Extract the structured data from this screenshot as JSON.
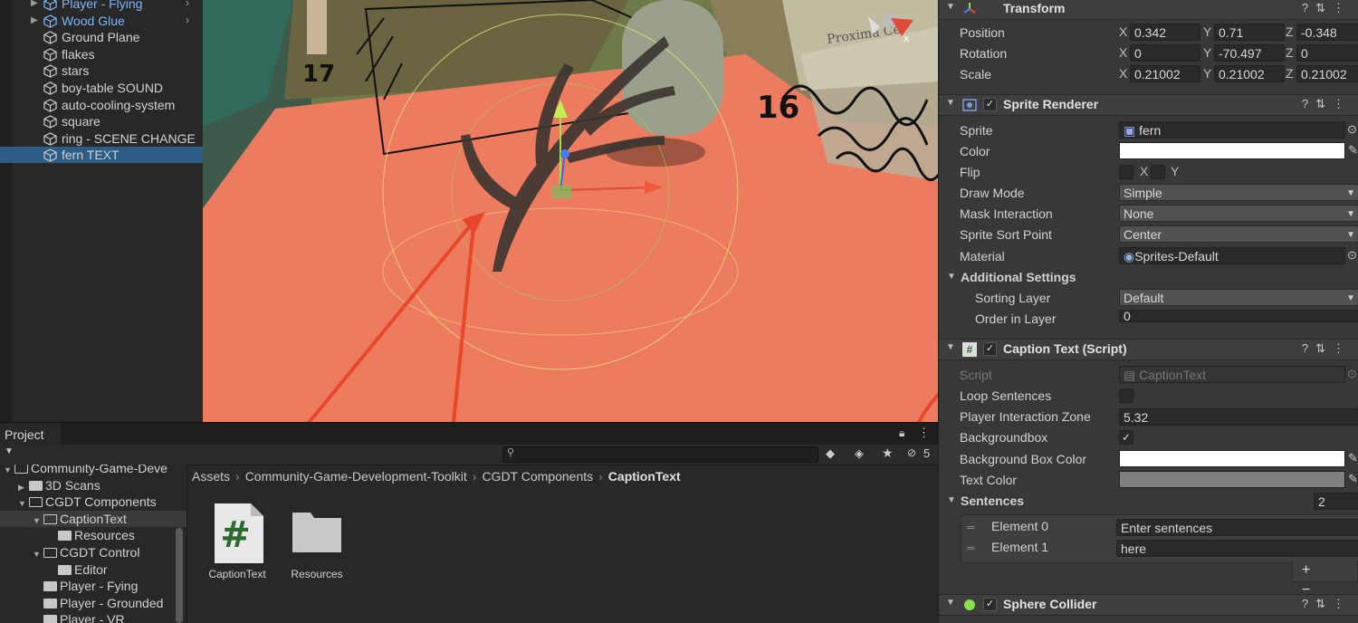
{
  "hierarchy": {
    "items": [
      {
        "label": "Player - Flying",
        "prefab": true
      },
      {
        "label": "Wood Glue",
        "prefab": true
      },
      {
        "label": "Ground Plane",
        "prefab": false
      },
      {
        "label": "flakes",
        "prefab": false
      },
      {
        "label": "stars",
        "prefab": false
      },
      {
        "label": "boy-table SOUND",
        "prefab": false
      },
      {
        "label": "auto-cooling-system",
        "prefab": false
      },
      {
        "label": "square",
        "prefab": false
      },
      {
        "label": "ring - SCENE CHANGE",
        "prefab": false
      },
      {
        "label": "fern TEXT",
        "prefab": false,
        "selected": true
      }
    ]
  },
  "scene": {
    "label_17": "17",
    "label_16": "16",
    "gizmo_x": "x",
    "bg_text": "Proxima Ce"
  },
  "project": {
    "tab_label": "Project",
    "hidden_count": "5",
    "tree": [
      {
        "label": "Community-Game-Deve",
        "indent": 0,
        "open": true
      },
      {
        "label": "3D Scans",
        "indent": 1,
        "open": false
      },
      {
        "label": "CGDT Components",
        "indent": 1,
        "open": true
      },
      {
        "label": "CaptionText",
        "indent": 2,
        "open": true,
        "selected": true
      },
      {
        "label": "Resources",
        "indent": 3,
        "open": false,
        "leaf": true
      },
      {
        "label": "CGDT Control",
        "indent": 2,
        "open": true
      },
      {
        "label": "Editor",
        "indent": 3,
        "open": false,
        "leaf": true
      },
      {
        "label": "Player - Fying",
        "indent": 2,
        "open": false,
        "leaf": true
      },
      {
        "label": "Player - Grounded",
        "indent": 2,
        "open": false,
        "leaf": true
      },
      {
        "label": "Player - VR",
        "indent": 2,
        "open": false,
        "leaf": true
      }
    ],
    "breadcrumb": [
      "Assets",
      "Community-Game-Development-Toolkit",
      "CGDT Components",
      "CaptionText"
    ],
    "assets": [
      {
        "name": "CaptionText",
        "kind": "script",
        "glyph": "#"
      },
      {
        "name": "Resources",
        "kind": "folder"
      }
    ]
  },
  "inspector": {
    "transform": {
      "title": "Transform",
      "position_label": "Position",
      "rotation_label": "Rotation",
      "scale_label": "Scale",
      "axis_x": "X",
      "axis_y": "Y",
      "axis_z": "Z",
      "position": {
        "x": "0.342",
        "y": "0.71",
        "z": "-0.348"
      },
      "rotation": {
        "x": "0",
        "y": "-70.497",
        "z": "0"
      },
      "scale": {
        "x": "0.21002",
        "y": "0.21002",
        "z": "0.21002"
      }
    },
    "sprite_renderer": {
      "title": "Sprite Renderer",
      "sprite_label": "Sprite",
      "sprite_value": "fern",
      "color_label": "Color",
      "color_value": "#ffffff",
      "flip_label": "Flip",
      "flip_x": "X",
      "flip_y": "Y",
      "draw_mode_label": "Draw Mode",
      "draw_mode_value": "Simple",
      "mask_label": "Mask Interaction",
      "mask_value": "None",
      "sort_point_label": "Sprite Sort Point",
      "sort_point_value": "Center",
      "material_label": "Material",
      "material_value": "Sprites-Default",
      "additional_label": "Additional Settings",
      "sorting_layer_label": "Sorting Layer",
      "sorting_layer_value": "Default",
      "order_label": "Order in Layer",
      "order_value": "0"
    },
    "caption_text": {
      "title": "Caption Text (Script)",
      "script_label": "Script",
      "script_value": "CaptionText",
      "loop_label": "Loop Sentences",
      "loop_checked": false,
      "zone_label": "Player Interaction Zone",
      "zone_value": "5.32",
      "bgbox_label": "Backgroundbox",
      "bgbox_checked": true,
      "bgbox_color_label": "Background Box Color",
      "bgbox_color": "#ffffff",
      "text_color_label": "Text Color",
      "text_color": "#808080",
      "sentences_label": "Sentences",
      "sentences_count": "2",
      "elements": [
        {
          "label": "Element 0",
          "value": "Enter sentences"
        },
        {
          "label": "Element 1",
          "value": "here"
        }
      ],
      "add_remove": "+ −"
    },
    "sphere_collider": {
      "title": "Sphere Collider"
    }
  },
  "colors": {
    "accent_selection": "#2c5d87",
    "prefab_blue": "#7fb5f5",
    "annotation_red": "#e8472b",
    "floor_salmon": "#e9795a"
  }
}
